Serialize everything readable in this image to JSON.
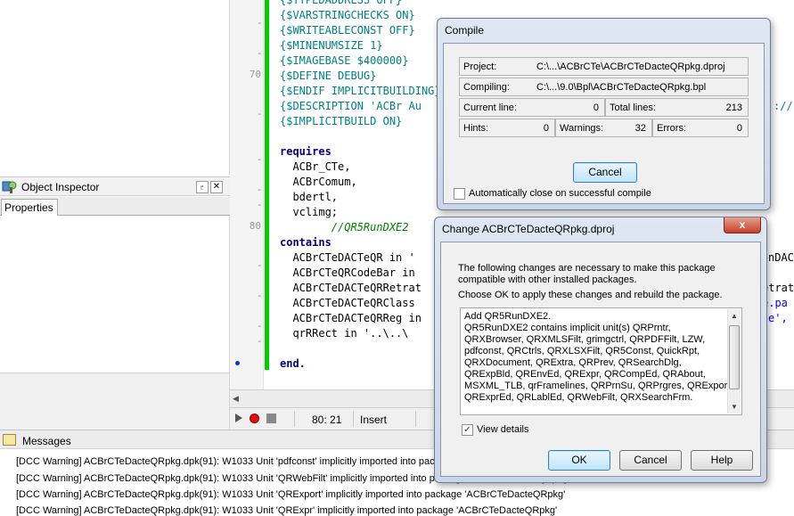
{
  "object_inspector": {
    "title": "Object Inspector",
    "pin": "♇",
    "close": "✕",
    "tab": "Properties"
  },
  "editor": {
    "gutter": {
      "n70": "70",
      "n80": "80"
    },
    "lines": [
      "{$TYPEDADDRESS OFF}",
      "{$VARSTRINGCHECKS ON}",
      "{$WRITEABLECONST OFF}",
      "{$MINENUMSIZE 1}",
      "{$IMAGEBASE $400000}",
      "{$DEFINE DEBUG}",
      "{$ENDIF IMPLICITBUILDING}",
      "{$DESCRIPTION 'ACBr Au",
      "{$IMPLICITBUILD ON}",
      "requires",
      "  ACBr_CTe,",
      "  ACBrComum,",
      "  bdertl,",
      "  vclimg;",
      "        //QR5RunDXE2",
      "contains",
      "  ACBrCTeDACTeQR in '",
      "  ACBrCTeQRCodeBar in",
      "  ACBrCTeDACTeQRRetrat",
      "  ACBrCTeDACTeQRClass",
      "  ACBrCTeDACTeQRReg in",
      "  qrRRect in '..\\..\\",
      "end."
    ],
    "right_frag": {
      "r8": "://",
      "r17": "nDAC",
      "r19": "etrat",
      "r20": "e.pa",
      "r21": "e',"
    }
  },
  "status_bar": {
    "position": "80: 21",
    "mode": "Insert"
  },
  "messages": {
    "title": "Messages",
    "items": [
      "[DCC Warning] ACBrCTeDacteQRpkg.dpk(91): W1033 Unit 'pdfconst' implicitly imported into package 'ACBrCTeDacteQRpkg'",
      "[DCC Warning] ACBrCTeDacteQRpkg.dpk(91): W1033 Unit 'QRWebFilt' implicitly imported into package 'ACBrCTeDacteQRpkg'",
      "[DCC Warning] ACBrCTeDacteQRpkg.dpk(91): W1033 Unit 'QRExport' implicitly imported into package 'ACBrCTeDacteQRpkg'",
      "[DCC Warning] ACBrCTeDacteQRpkg.dpk(91): W1033 Unit 'QRExpr' implicitly imported into package 'ACBrCTeDacteQRpkg'"
    ]
  },
  "compile_dialog": {
    "title": "Compile",
    "project_label": "Project:",
    "project_value": "C:\\...\\ACBrCTe\\ACBrCTeDacteQRpkg.dproj",
    "compiling_label": "Compiling:",
    "compiling_value": "C:\\...\\9.0\\Bpl\\ACBrCTeDacteQRpkg.bpl",
    "current_line_label": "Current line:",
    "current_line_value": "0",
    "total_lines_label": "Total lines:",
    "total_lines_value": "213",
    "hints_label": "Hints:",
    "hints_value": "0",
    "warnings_label": "Warnings:",
    "warnings_value": "32",
    "errors_label": "Errors:",
    "errors_value": "0",
    "cancel_label": "Cancel",
    "auto_close_label": "Automatically close on successful compile"
  },
  "change_dialog": {
    "title": "Change ACBrCTeDacteQRpkg.dproj",
    "close": "x",
    "msg1": "The following changes are necessary to make this package\ncompatible with other installed packages.",
    "msg2": "Choose OK to apply these changes and rebuild the package.",
    "details": "Add QR5RunDXE2.\nQR5RunDXE2 contains implicit unit(s) QRPrntr,\nQRXBrowser, QRXMLSFilt, grimgctrl, QRPDFFilt, LZW,\npdfconst, QRCtrls, QRXLSXFilt, QR5Const, QuickRpt,\nQRXDocument, QRExtra, QRPrev, QRSearchDlg,\nQRExpBld, QREnvEd, QRExpr, QRCompEd, QRAbout,\nMSXML_TLB, qrFramelines, QRPrnSu, QRPrgres, QRExport,\nQRExprEd, QRLablEd, QRWebFilt, QRXSearchFrm.",
    "view_details_label": "View details",
    "view_details_check": "✓",
    "ok_label": "OK",
    "cancel_label": "Cancel",
    "help_label": "Help"
  }
}
